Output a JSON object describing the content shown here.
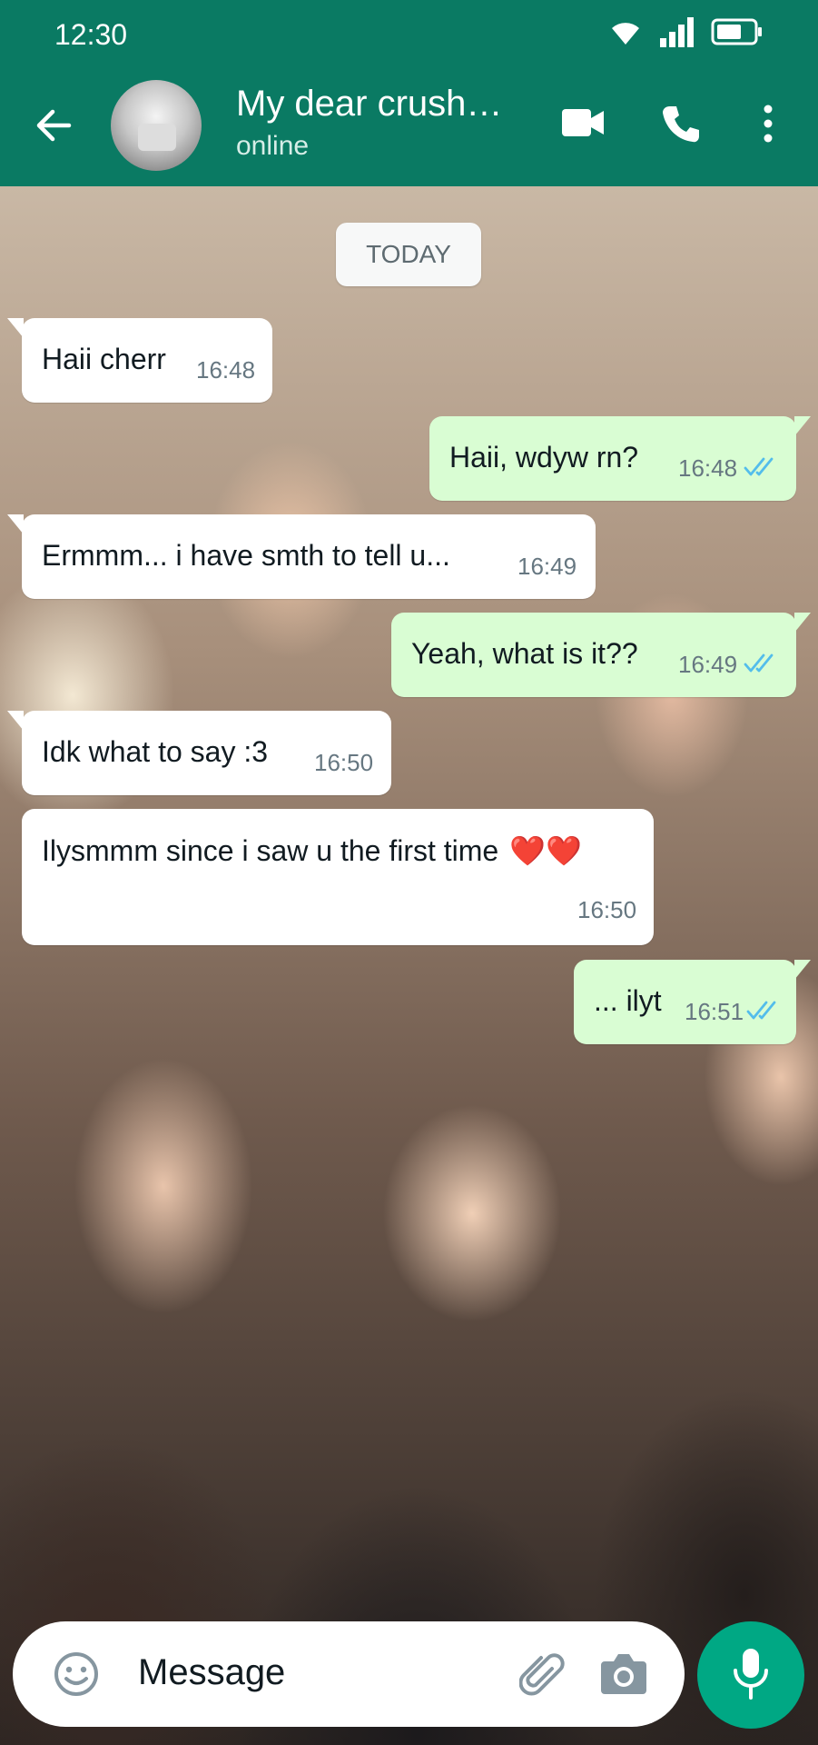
{
  "status_bar": {
    "time": "12:30"
  },
  "header": {
    "contact_name": "My dear crush…",
    "status": "online"
  },
  "chat": {
    "date_chip": "TODAY",
    "messages": [
      {
        "dir": "in",
        "text": "Haii cherr",
        "time": "16:48"
      },
      {
        "dir": "out",
        "text": "Haii, wdyw rn?",
        "time": "16:48",
        "read": true
      },
      {
        "dir": "in",
        "text": "Ermmm... i have smth to tell u...",
        "time": "16:49"
      },
      {
        "dir": "out",
        "text": "Yeah, what is it??",
        "time": "16:49",
        "read": true
      },
      {
        "dir": "in",
        "text": "Idk what to say :3",
        "time": "16:50"
      },
      {
        "dir": "in",
        "text": "Ilysmmm since i saw u the first time",
        "time": "16:50",
        "emojis": "❤️❤️"
      },
      {
        "dir": "out",
        "text": "... ilyt",
        "time": "16:51",
        "read": true
      }
    ]
  },
  "composer": {
    "placeholder": "Message"
  },
  "icons": {
    "back": "arrow-left-icon",
    "video": "video-call-icon",
    "call": "phone-icon",
    "menu": "more-vertical-icon",
    "emoji": "emoji-icon",
    "attach": "paperclip-icon",
    "camera": "camera-icon",
    "mic": "microphone-icon",
    "read": "double-check-icon"
  },
  "colors": {
    "header": "#0a7a63",
    "outgoing_bubble": "#d9fdd3",
    "incoming_bubble": "#ffffff",
    "read_ticks": "#53bdeb",
    "mic_button": "#00a884"
  }
}
